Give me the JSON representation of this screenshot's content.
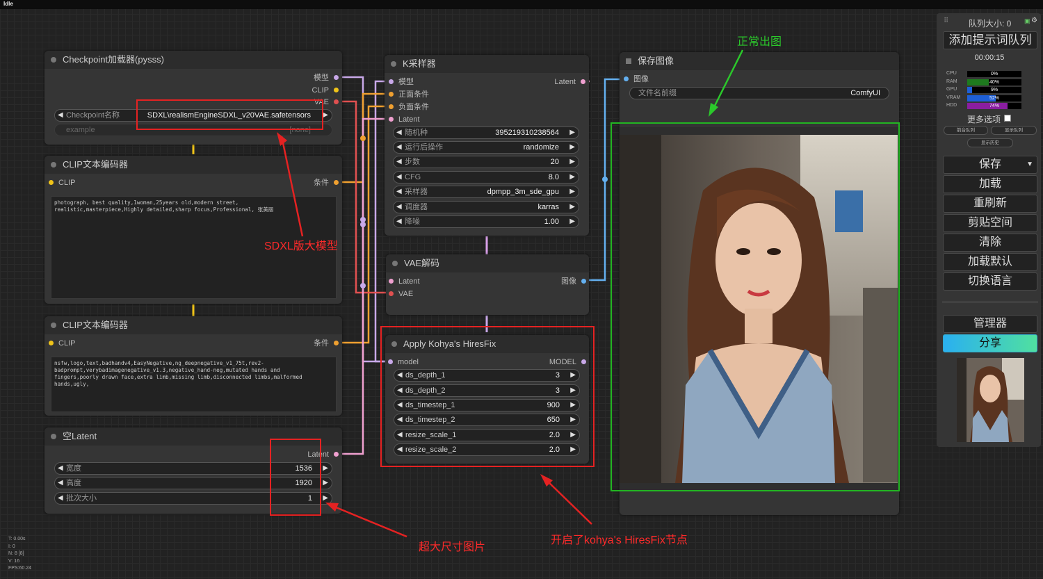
{
  "window": {
    "status": "Idle"
  },
  "nodes": {
    "checkpoint": {
      "title": "Checkpoint加载器(pysss)",
      "outputs": [
        "模型",
        "CLIP",
        "VAE"
      ],
      "ckpt_label": "Checkpoint名称",
      "ckpt_value": "SDXL\\realismEngineSDXL_v20VAE.safetensors",
      "example_label": "example",
      "example_value": "[none]"
    },
    "clip_pos": {
      "title": "CLIP文本编码器",
      "input": "CLIP",
      "output": "条件",
      "text": "photograph, best quality,1woman,25years old,modern street,\nrealistic,masterpiece,Highly detailed,sharp focus,Professional, 张美丽"
    },
    "clip_neg": {
      "title": "CLIP文本编码器",
      "input": "CLIP",
      "output": "条件",
      "text": "nsfw,logo,text,badhandv4,EasyNegative,ng_deepnegative_v1_75t,rev2-\nbadprompt,verybadimagenegative_v1.3,negative_hand-neg,mutated hands and\nfingers,poorly drawn face,extra limb,missing limb,disconnected limbs,malformed\nhands,ugly,"
    },
    "latent": {
      "title": "空Latent",
      "output": "Latent",
      "widgets": [
        {
          "label": "宽度",
          "value": "1536"
        },
        {
          "label": "高度",
          "value": "1920"
        },
        {
          "label": "批次大小",
          "value": "1"
        }
      ]
    },
    "ksampler": {
      "title": "K采样器",
      "inputs": [
        "模型",
        "正面条件",
        "负面条件",
        "Latent"
      ],
      "output": "Latent",
      "widgets": [
        {
          "label": "随机种",
          "value": "395219310238564"
        },
        {
          "label": "运行后操作",
          "value": "randomize"
        },
        {
          "label": "步数",
          "value": "20"
        },
        {
          "label": "CFG",
          "value": "8.0"
        },
        {
          "label": "采样器",
          "value": "dpmpp_3m_sde_gpu"
        },
        {
          "label": "调度器",
          "value": "karras"
        },
        {
          "label": "降噪",
          "value": "1.00"
        }
      ]
    },
    "vae_decode": {
      "title": "VAE解码",
      "inputs": [
        "Latent",
        "VAE"
      ],
      "output": "图像"
    },
    "hiresfix": {
      "title": "Apply Kohya's HiresFix",
      "input": "model",
      "output": "MODEL",
      "widgets": [
        {
          "label": "ds_depth_1",
          "value": "3"
        },
        {
          "label": "ds_depth_2",
          "value": "3"
        },
        {
          "label": "ds_timestep_1",
          "value": "900"
        },
        {
          "label": "ds_timestep_2",
          "value": "650"
        },
        {
          "label": "resize_scale_1",
          "value": "2.0"
        },
        {
          "label": "resize_scale_2",
          "value": "2.0"
        }
      ]
    },
    "save_image": {
      "title": "保存图像",
      "input": "图像",
      "prefix_label": "文件名前缀",
      "prefix_value": "ComfyUI"
    }
  },
  "annotations": {
    "sdxl": "SDXL版大模型",
    "big_size": "超大尺寸图片",
    "hiresfix": "开启了kohya's HiresFix节点",
    "normal": "正常出图"
  },
  "stats": [
    "T: 0.00s",
    "I: 0",
    "N: 8 [8]",
    "V: 16",
    "FPS:60.24"
  ],
  "panel": {
    "queue_size": "队列大小: 0",
    "queue_prompt": "添加提示词队列",
    "timer": "00:00:15",
    "meters": [
      {
        "name": "CPU",
        "pct": "0%",
        "value": 0,
        "color": "#2a8a2a"
      },
      {
        "name": "RAM",
        "pct": "40%",
        "value": 40,
        "color": "#1e7a1e"
      },
      {
        "name": "GPU",
        "pct": "9%",
        "value": 9,
        "color": "#1e5fd6"
      },
      {
        "name": "VRAM",
        "pct": "52%",
        "value": 52,
        "color": "#1e5fd6"
      },
      {
        "name": "HDD",
        "pct": "74%",
        "value": 74,
        "color": "#8a1ea0"
      }
    ],
    "more_options": "更多选项",
    "front_queue": "前台队列",
    "show_queue": "显示队列",
    "show_history": "显示历史",
    "buttons": [
      "保存",
      "加载",
      "重刷新",
      "剪贴空间",
      "清除",
      "加载默认",
      "切换语言"
    ],
    "manager": "管理器",
    "share": "分享"
  }
}
